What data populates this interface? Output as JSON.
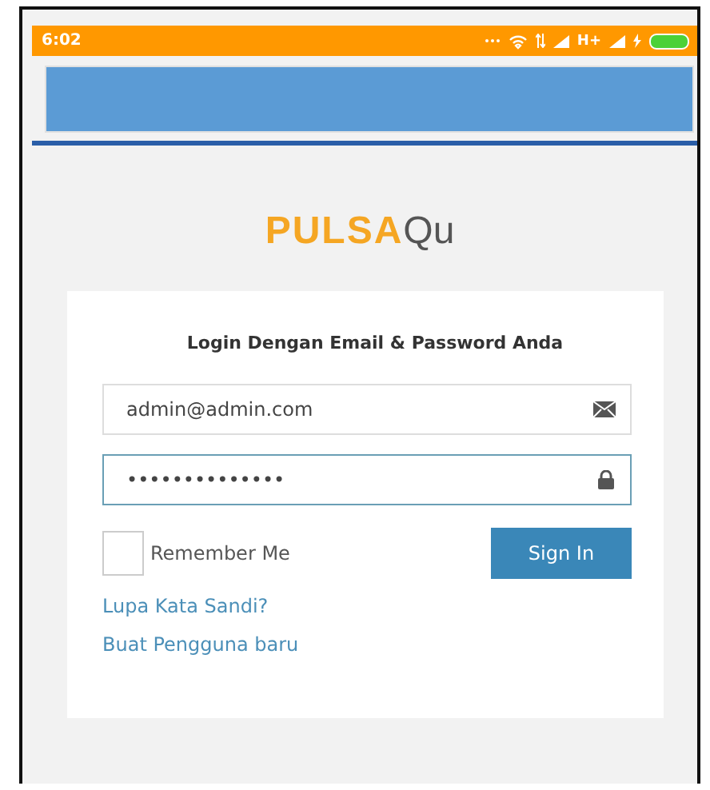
{
  "status_bar": {
    "time": "6:02",
    "network": "H+"
  },
  "logo": {
    "brand": "PULSA",
    "suffix": "Qu"
  },
  "login": {
    "heading": "Login Dengan Email & Password Anda",
    "email": {
      "value": "admin@admin.com"
    },
    "password": {
      "value": "••••••••••••••"
    },
    "remember": {
      "label": "Remember Me",
      "checked": false
    },
    "submit": "Sign In",
    "links": [
      "Lupa Kata Sandi?",
      "Buat Pengguna baru"
    ]
  }
}
